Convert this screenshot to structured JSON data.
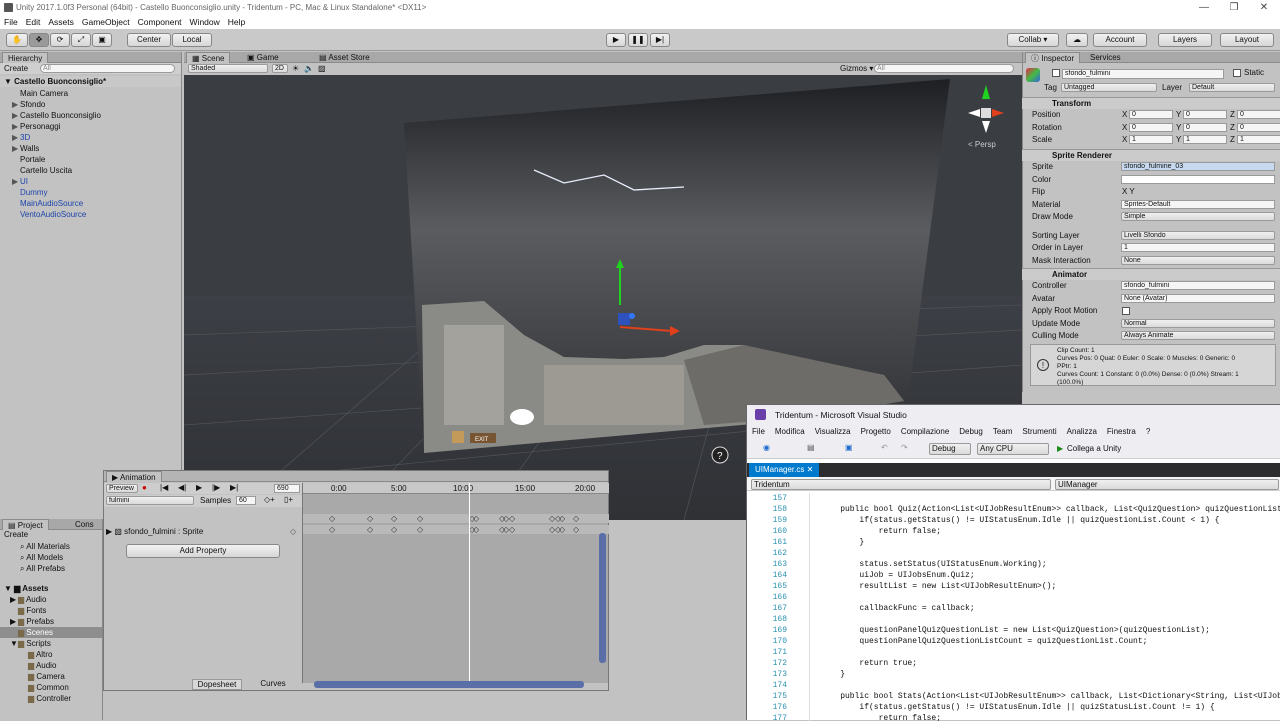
{
  "window": {
    "title": "Unity 2017.1.0f3 Personal (64bit) - Castello Buonconsiglio.unity - Tridentum - PC, Mac & Linux Standalone* <DX11>",
    "minimize": "—",
    "maximize": "❐",
    "close": "✕"
  },
  "menu": [
    "File",
    "Edit",
    "Assets",
    "GameObject",
    "Component",
    "Window",
    "Help"
  ],
  "toolbar": {
    "center": "Center",
    "local": "Local",
    "collab": "Collab ▾",
    "account": "Account",
    "layers": "Layers",
    "layout": "Layout"
  },
  "hierarchy": {
    "tab": "Hierarchy",
    "create": "Create",
    "search_placeholder": "All",
    "scene": "Castello Buonconsiglio*",
    "items": [
      {
        "label": "Main Camera",
        "blue": false,
        "arrow": ""
      },
      {
        "label": "Sfondo",
        "blue": false,
        "arrow": "▶"
      },
      {
        "label": "Castello Buonconsiglio",
        "blue": false,
        "arrow": "▶"
      },
      {
        "label": "Personaggi",
        "blue": false,
        "arrow": "▶"
      },
      {
        "label": "3D",
        "blue": true,
        "arrow": "▶"
      },
      {
        "label": "Walls",
        "blue": false,
        "arrow": "▶"
      },
      {
        "label": "Portale",
        "blue": false,
        "arrow": ""
      },
      {
        "label": "Cartello Uscita",
        "blue": false,
        "arrow": ""
      },
      {
        "label": "UI",
        "blue": true,
        "arrow": "▶"
      },
      {
        "label": "Dummy",
        "blue": true,
        "arrow": ""
      },
      {
        "label": "MainAudioSource",
        "blue": true,
        "arrow": ""
      },
      {
        "label": "VentoAudioSource",
        "blue": true,
        "arrow": ""
      }
    ]
  },
  "scene": {
    "tabs": [
      "Scene",
      "Game",
      "Asset Store"
    ],
    "shaded": "Shaded",
    "mode2d": "2D",
    "gizmos": "Gizmos ▾",
    "search_placeholder": "All",
    "persp": "< Persp",
    "exit_label": "EXIT"
  },
  "project": {
    "tabs": [
      "Project",
      "Cons"
    ],
    "create": "Create",
    "favorites": [
      "All Materials",
      "All Models",
      "All Prefabs"
    ],
    "assets": "Assets",
    "items": [
      {
        "label": "Audio",
        "indent": 1,
        "arrow": "▶"
      },
      {
        "label": "Fonts",
        "indent": 1,
        "arrow": ""
      },
      {
        "label": "Prefabs",
        "indent": 1,
        "arrow": "▶"
      },
      {
        "label": "Scenes",
        "indent": 1,
        "arrow": ""
      },
      {
        "label": "Scripts",
        "indent": 1,
        "arrow": "▼"
      },
      {
        "label": "Altro",
        "indent": 2,
        "arrow": ""
      },
      {
        "label": "Audio",
        "indent": 2,
        "arrow": ""
      },
      {
        "label": "Camera",
        "indent": 2,
        "arrow": ""
      },
      {
        "label": "Common",
        "indent": 2,
        "arrow": ""
      },
      {
        "label": "Controller",
        "indent": 2,
        "arrow": ""
      }
    ]
  },
  "inspector": {
    "tabs": [
      "Inspector",
      "Services"
    ],
    "object_name": "sfondo_fulmini",
    "static": "Static",
    "tag_label": "Tag",
    "tag": "Untagged",
    "layer_label": "Layer",
    "layer": "Default",
    "transform": {
      "title": "Transform",
      "rows": [
        {
          "label": "Position",
          "x": "0",
          "y": "0",
          "z": "0"
        },
        {
          "label": "Rotation",
          "x": "0",
          "y": "0",
          "z": "0"
        },
        {
          "label": "Scale",
          "x": "1",
          "y": "1",
          "z": "1"
        }
      ]
    },
    "sprite_renderer": {
      "title": "Sprite Renderer",
      "rows": [
        {
          "label": "Sprite",
          "value": "sfondo_fulmine_03"
        },
        {
          "label": "Color",
          "value": ""
        },
        {
          "label": "Flip",
          "value": "X    Y"
        },
        {
          "label": "Material",
          "value": "Sprites-Default"
        },
        {
          "label": "Draw Mode",
          "value": "Simple"
        },
        {
          "label": "Sorting Layer",
          "value": "Livelli Sfondo"
        },
        {
          "label": "Order in Layer",
          "value": "1"
        },
        {
          "label": "Mask Interaction",
          "value": "None"
        }
      ]
    },
    "animator": {
      "title": "Animator",
      "rows": [
        {
          "label": "Controller",
          "value": "sfondo_fulmini"
        },
        {
          "label": "Avatar",
          "value": "None (Avatar)"
        },
        {
          "label": "Apply Root Motion",
          "value": ""
        },
        {
          "label": "Update Mode",
          "value": "Normal"
        },
        {
          "label": "Culling Mode",
          "value": "Always Animate"
        }
      ],
      "info": "Clip Count: 1\nCurves Pos: 0 Quat: 0 Euler: 0 Scale: 0 Muscles: 0 Generic: 0\nPPtr: 1\nCurves Count: 1 Constant: 0 (0.0%) Dense: 0 (0.0%) Stream: 1\n(100.0%)"
    }
  },
  "animation": {
    "tab": "Animation",
    "preview": "Preview",
    "frame": "690",
    "clip": "fulmini",
    "samples_label": "Samples",
    "samples": "60",
    "property": "sfondo_fulmini : Sprite",
    "add_property": "Add Property",
    "times": [
      "0:00",
      "5:00",
      "10:00",
      "15:00",
      "20:00"
    ],
    "bottom_tabs": [
      "Dopesheet",
      "Curves"
    ]
  },
  "vs": {
    "title": "Tridentum - Microsoft Visual Studio",
    "menu": [
      "File",
      "Modifica",
      "Visualizza",
      "Progetto",
      "Compilazione",
      "Debug",
      "Team",
      "Strumenti",
      "Analizza",
      "Finestra",
      "?"
    ],
    "config": "Debug",
    "platform": "Any CPU",
    "attach": "Collega a Unity",
    "file_tab": "UIManager.cs",
    "nav_left": "Tridentum",
    "nav_right": "UIManager",
    "lines": [
      {
        "n": "157",
        "t": ""
      },
      {
        "n": "158",
        "t": "    public bool Quiz(Action<List<UIJobResultEnum>> callback, List<QuizQuestion> quizQuestionList) {"
      },
      {
        "n": "159",
        "t": "        if(status.getStatus() != UIStatusEnum.Idle || quizQuestionList.Count < 1) {"
      },
      {
        "n": "160",
        "t": "            return false;"
      },
      {
        "n": "161",
        "t": "        }"
      },
      {
        "n": "162",
        "t": ""
      },
      {
        "n": "163",
        "t": "        status.setStatus(UIStatusEnum.Working);"
      },
      {
        "n": "164",
        "t": "        uiJob = UIJobsEnum.Quiz;"
      },
      {
        "n": "165",
        "t": "        resultList = new List<UIJobResultEnum>();"
      },
      {
        "n": "166",
        "t": ""
      },
      {
        "n": "167",
        "t": "        callbackFunc = callback;"
      },
      {
        "n": "168",
        "t": ""
      },
      {
        "n": "169",
        "t": "        questionPanelQuizQuestionList = new List<QuizQuestion>(quizQuestionList);"
      },
      {
        "n": "170",
        "t": "        questionPanelQuizQuestionListCount = quizQuestionList.Count;"
      },
      {
        "n": "171",
        "t": ""
      },
      {
        "n": "172",
        "t": "        return true;"
      },
      {
        "n": "173",
        "t": "    }"
      },
      {
        "n": "174",
        "t": ""
      },
      {
        "n": "175",
        "t": "    public bool Stats(Action<List<UIJobResultEnum>> callback, List<Dictionary<String, List<UIJobResult"
      },
      {
        "n": "176",
        "t": "        if(status.getStatus() != UIStatusEnum.Idle || quizStatusList.Count != 1) {"
      },
      {
        "n": "177",
        "t": "            return false;"
      }
    ]
  }
}
